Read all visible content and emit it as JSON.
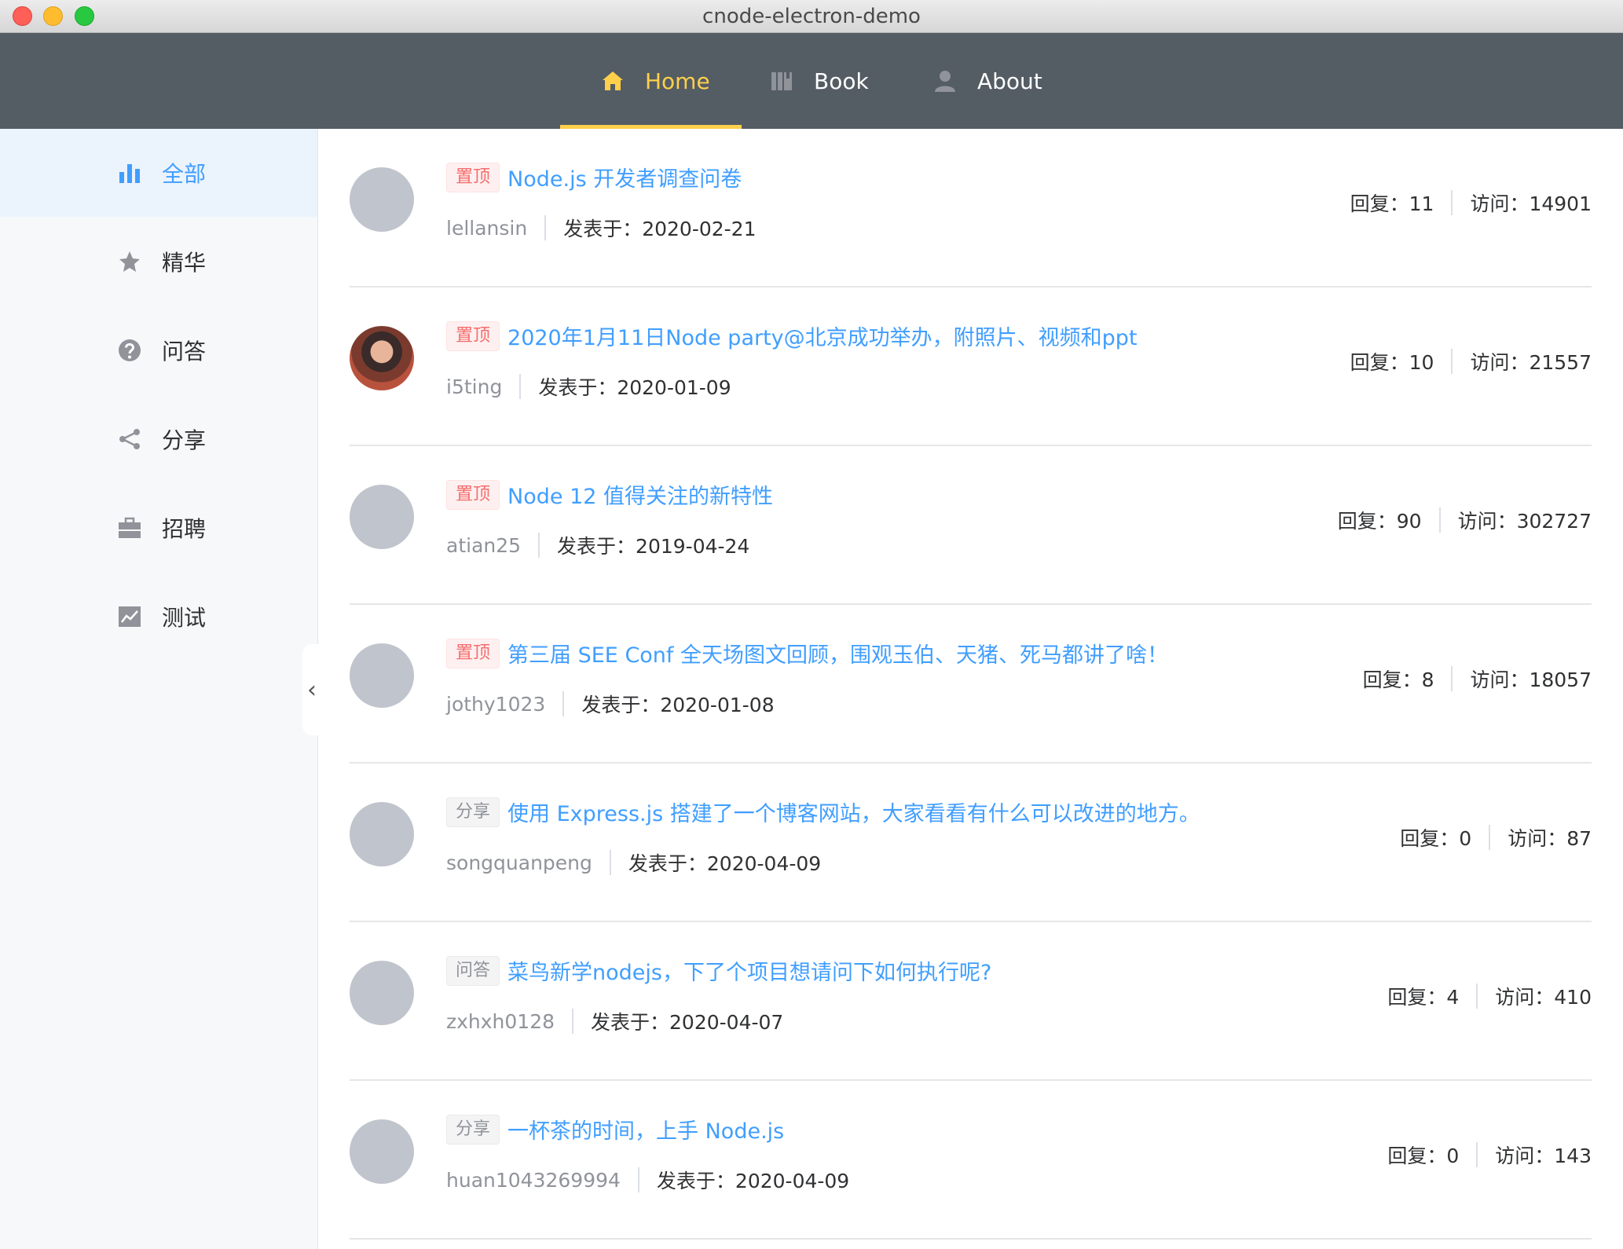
{
  "window": {
    "title": "cnode-electron-demo"
  },
  "nav": {
    "items": [
      {
        "label": "Home",
        "icon": "home-icon",
        "active": true
      },
      {
        "label": "Book",
        "icon": "book-icon",
        "active": false
      },
      {
        "label": "About",
        "icon": "user-icon",
        "active": false
      }
    ],
    "active_color": "#ffd04b",
    "background": "#545c64"
  },
  "sidebar": {
    "items": [
      {
        "label": "全部",
        "icon": "bar-chart-icon",
        "active": true
      },
      {
        "label": "精华",
        "icon": "star-icon",
        "active": false
      },
      {
        "label": "问答",
        "icon": "question-icon",
        "active": false
      },
      {
        "label": "分享",
        "icon": "share-icon",
        "active": false
      },
      {
        "label": "招聘",
        "icon": "briefcase-icon",
        "active": false
      },
      {
        "label": "测试",
        "icon": "line-chart-icon",
        "active": false
      }
    ],
    "collapse_glyph": "‹"
  },
  "topics": [
    {
      "tag": "置顶",
      "tag_type": "top",
      "title": "Node.js 开发者调查问卷",
      "author": "lellansin",
      "posted": "发表于：2020-02-21",
      "replies": "回复：11",
      "visits": "访问：14901",
      "avatar": "placeholder"
    },
    {
      "tag": "置顶",
      "tag_type": "top",
      "title": "2020年1月11日Node party@北京成功举办，附照片、视频和ppt",
      "author": "i5ting",
      "posted": "发表于：2020-01-09",
      "replies": "回复：10",
      "visits": "访问：21557",
      "avatar": "photo"
    },
    {
      "tag": "置顶",
      "tag_type": "top",
      "title": "Node 12 值得关注的新特性",
      "author": "atian25",
      "posted": "发表于：2019-04-24",
      "replies": "回复：90",
      "visits": "访问：302727",
      "avatar": "placeholder"
    },
    {
      "tag": "置顶",
      "tag_type": "top",
      "title": "第三届 SEE Conf 全天场图文回顾，围观玉伯、天猪、死马都讲了啥！",
      "author": "jothy1023",
      "posted": "发表于：2020-01-08",
      "replies": "回复：8",
      "visits": "访问：18057",
      "avatar": "placeholder"
    },
    {
      "tag": "分享",
      "tag_type": "cat",
      "title": "使用 Express.js 搭建了一个博客网站，大家看看有什么可以改进的地方。",
      "author": "songquanpeng",
      "posted": "发表于：2020-04-09",
      "replies": "回复：0",
      "visits": "访问：87",
      "avatar": "placeholder"
    },
    {
      "tag": "问答",
      "tag_type": "cat",
      "title": "菜鸟新学nodejs，下了个项目想请问下如何执行呢?",
      "author": "zxhxh0128",
      "posted": "发表于：2020-04-07",
      "replies": "回复：4",
      "visits": "访问：410",
      "avatar": "placeholder"
    },
    {
      "tag": "分享",
      "tag_type": "cat",
      "title": "一杯茶的时间，上手 Node.js",
      "author": "huan1043269994",
      "posted": "发表于：2020-04-09",
      "replies": "回复：0",
      "visits": "访问：143",
      "avatar": "placeholder"
    }
  ],
  "colors": {
    "link": "#409eff",
    "top_tag": "#f56c6c",
    "sidebar_active_bg": "#ebf3fd"
  }
}
